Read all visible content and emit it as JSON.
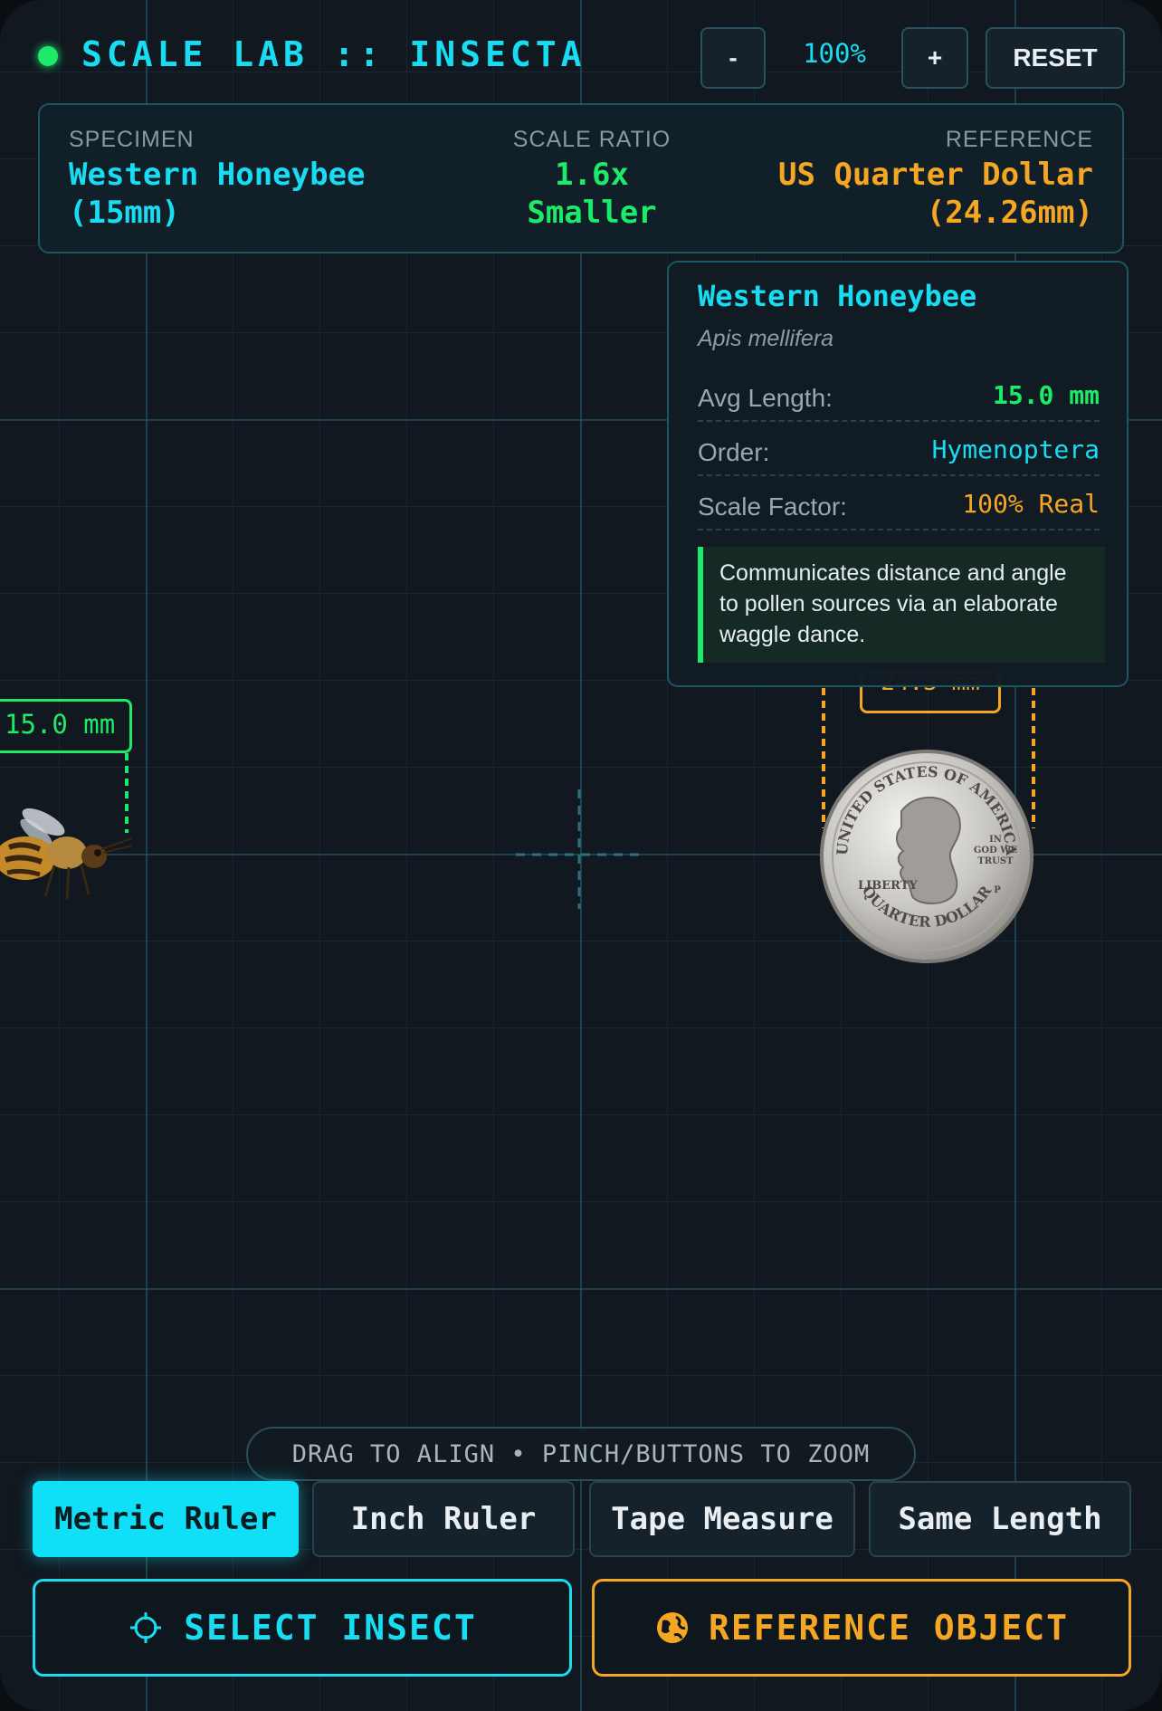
{
  "header": {
    "title": "SCALE LAB :: INSECTA",
    "zoom_out_label": "-",
    "zoom_value": "100%",
    "zoom_in_label": "+",
    "reset_label": "RESET"
  },
  "info_bar": {
    "specimen_label": "SPECIMEN",
    "specimen_line1": "Western Honeybee",
    "specimen_line2": "(15mm)",
    "ratio_label": "SCALE RATIO",
    "ratio_line1": "1.6x",
    "ratio_line2": "Smaller",
    "reference_label": "REFERENCE",
    "reference_line1": "US Quarter Dollar",
    "reference_line2": "(24.26mm)"
  },
  "detail_card": {
    "name": "Western Honeybee",
    "scientific_name": "Apis mellifera",
    "rows": [
      {
        "key": "Avg Length:",
        "value": "15.0 mm"
      },
      {
        "key": "Order:",
        "value": "Hymenoptera"
      },
      {
        "key": "Scale Factor:",
        "value": "100% Real"
      }
    ],
    "fact": "Communicates distance and angle to pollen sources via an elaborate waggle dance."
  },
  "canvas": {
    "specimen_measure": "15.0 mm",
    "reference_measure": "24.3 mm",
    "coin_top_text": "UNITED STATES OF AMERICA",
    "coin_bottom_text": "QUARTER DOLLAR",
    "coin_liberty": "LIBERTY",
    "coin_motto1": "IN",
    "coin_motto2": "GOD WE",
    "coin_motto3": "TRUST",
    "coin_mint": "P"
  },
  "hint": "DRAG TO ALIGN • PINCH/BUTTONS TO ZOOM",
  "ruler_tabs": [
    {
      "label": "Metric Ruler",
      "active": true
    },
    {
      "label": "Inch Ruler",
      "active": false
    },
    {
      "label": "Tape Measure",
      "active": false
    },
    {
      "label": "Same Length",
      "active": false
    }
  ],
  "actions": {
    "select_insect": "SELECT INSECT",
    "reference_object": "REFERENCE OBJECT"
  },
  "colors": {
    "accent_cyan": "#18dcf2",
    "accent_green": "#1eea6a",
    "accent_amber": "#f5a623",
    "background": "#111820"
  },
  "icons": {
    "select_insect": "crosshair-icon",
    "reference_object": "globe-icon"
  }
}
